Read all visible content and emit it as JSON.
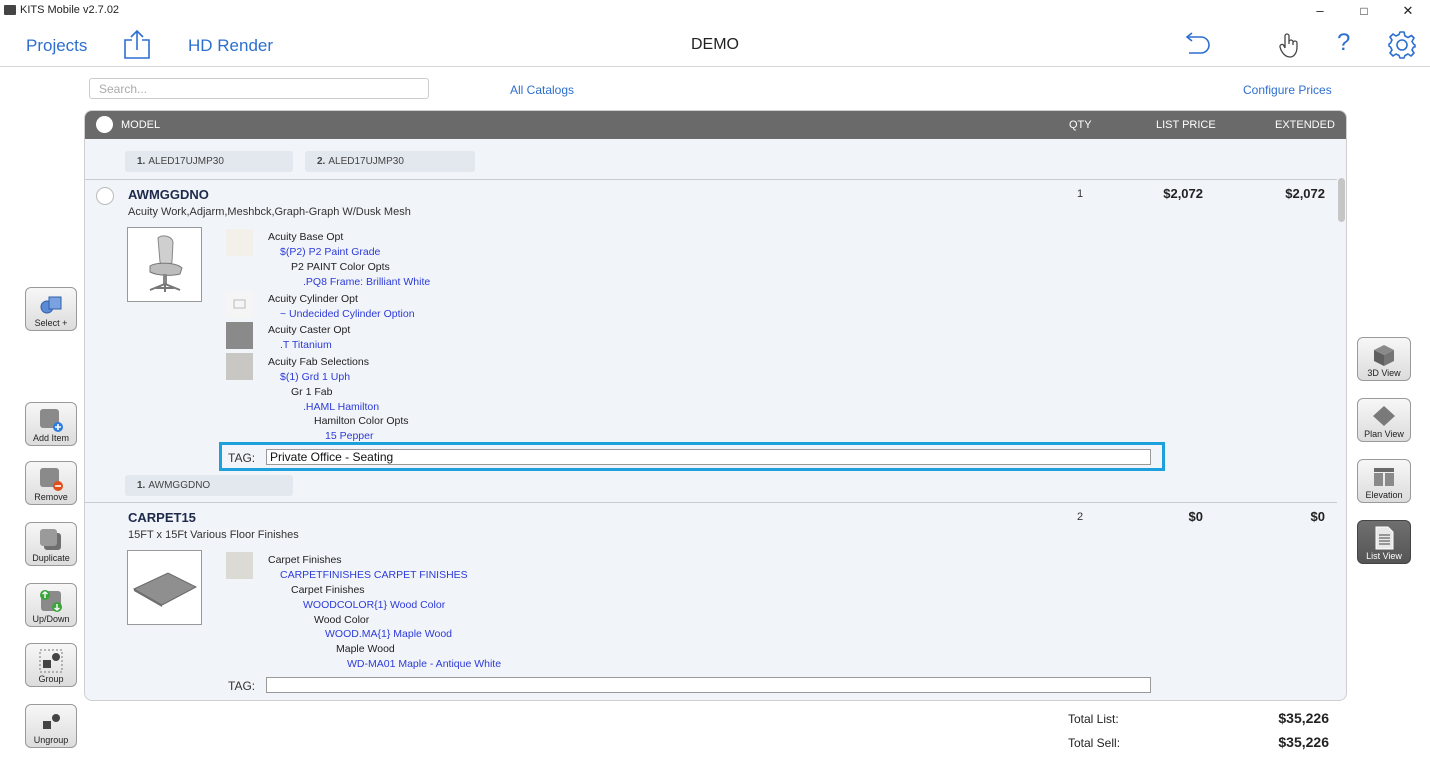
{
  "window": {
    "title": "KITS Mobile v2.7.02",
    "minimize": "–",
    "maximize": "□",
    "close": "✕"
  },
  "header": {
    "projects": "Projects",
    "hd_render": "HD Render",
    "title": "DEMO"
  },
  "search": {
    "placeholder": "Search..."
  },
  "links": {
    "all_catalogs": "All Catalogs",
    "configure_prices": "Configure Prices"
  },
  "columns": {
    "model": "MODEL",
    "qty": "QTY",
    "list_price": "LIST PRICE",
    "extended": "EXTENDED"
  },
  "top_pills": [
    {
      "num": "1.",
      "label": "ALED17UJMP30"
    },
    {
      "num": "2.",
      "label": "ALED17UJMP30"
    }
  ],
  "items": [
    {
      "model": "AWMGGDNO",
      "description": "Acuity Work,Adjarm,Meshbck,Graph-Graph W/Dusk Mesh",
      "qty": "1",
      "list_price": "$2,072",
      "extended": "$2,072",
      "options": [
        "Acuity Base Opt",
        "$(P2)   P2 Paint Grade",
        "P2 PAINT Color Opts",
        ".PQ8   Frame: Brilliant White",
        "Acuity Cylinder Opt",
        "~   Undecided Cylinder Option",
        "Acuity Caster Opt",
        ".T   Titanium",
        "Acuity Fab Selections",
        "$(1)   Grd 1 Uph",
        "Gr 1 Fab",
        ".HAML   Hamilton",
        "Hamilton Color Opts",
        "15   Pepper"
      ],
      "tag_label": "TAG:",
      "tag": "Private Office - Seating",
      "pill": {
        "num": "1.",
        "label": "AWMGGDNO"
      }
    },
    {
      "model": "CARPET15",
      "description": "15FT x 15Ft Various Floor Finishes",
      "qty": "2",
      "list_price": "$0",
      "extended": "$0",
      "options": [
        "Carpet Finishes",
        "CARPETFINISHES   CARPET FINISHES",
        "Carpet Finishes",
        "WOODCOLOR{1}   Wood Color",
        "Wood Color",
        "WOOD.MA{1}   Maple Wood",
        "Maple Wood",
        "WD-MA01   Maple - Antique White"
      ],
      "tag_label": "TAG:",
      "tag": ""
    }
  ],
  "left_toolbar": [
    "Select +",
    "Add Item",
    "Remove",
    "Duplicate",
    "Up/Down",
    "Group",
    "Ungroup"
  ],
  "right_toolbar": [
    "3D View",
    "Plan View",
    "Elevation",
    "List View"
  ],
  "right_toolbar_active": "List View",
  "totals": {
    "list_label": "Total List:",
    "list_value": "$35,226",
    "sell_label": "Total Sell:",
    "sell_value": "$35,226"
  },
  "colors": {
    "accent": "#2d6fcf",
    "option_value": "#2d3bd8",
    "highlight": "#1ea0dc",
    "header_bar": "#6a6a6a"
  }
}
